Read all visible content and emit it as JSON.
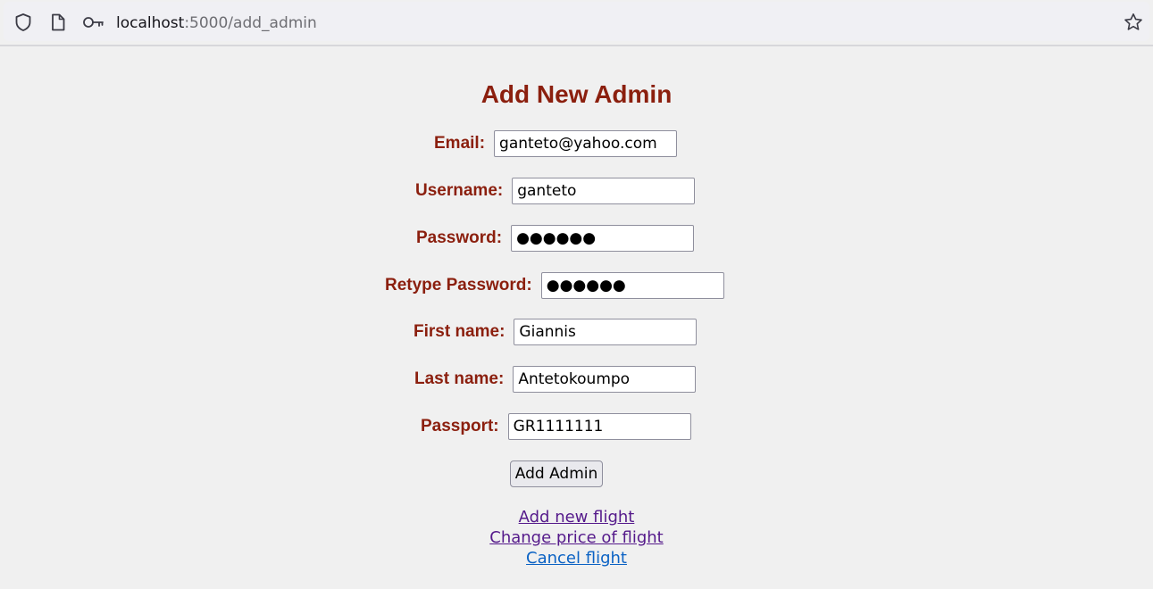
{
  "browser": {
    "url_host": "localhost",
    "url_path": ":5000/add_admin",
    "icons": {
      "shield": "shield-icon",
      "page": "page-icon",
      "key": "key-icon",
      "bookmark": "star-icon"
    }
  },
  "page": {
    "title": "Add New Admin",
    "fields": {
      "email": {
        "label": "Email:",
        "value": "ganteto@yahoo.com"
      },
      "username": {
        "label": "Username:",
        "value": "ganteto"
      },
      "password": {
        "label": "Password:",
        "value": "●●●●●●"
      },
      "retype_password": {
        "label": "Retype Password:",
        "value": "●●●●●●"
      },
      "first_name": {
        "label": "First name:",
        "value": "Giannis"
      },
      "last_name": {
        "label": "Last name:",
        "value": "Antetokoumpo"
      },
      "passport": {
        "label": "Passport:",
        "value": "GR1111111"
      }
    },
    "submit_label": "Add Admin",
    "links": {
      "add_flight": "Add new flight",
      "change_price": "Change price of flight",
      "cancel_flight": "Cancel flight"
    },
    "colors": {
      "accent": "#8b1f0e",
      "link_visited": "#551a8b",
      "link": "#0b62c4",
      "background": "#f0f0f0"
    }
  }
}
